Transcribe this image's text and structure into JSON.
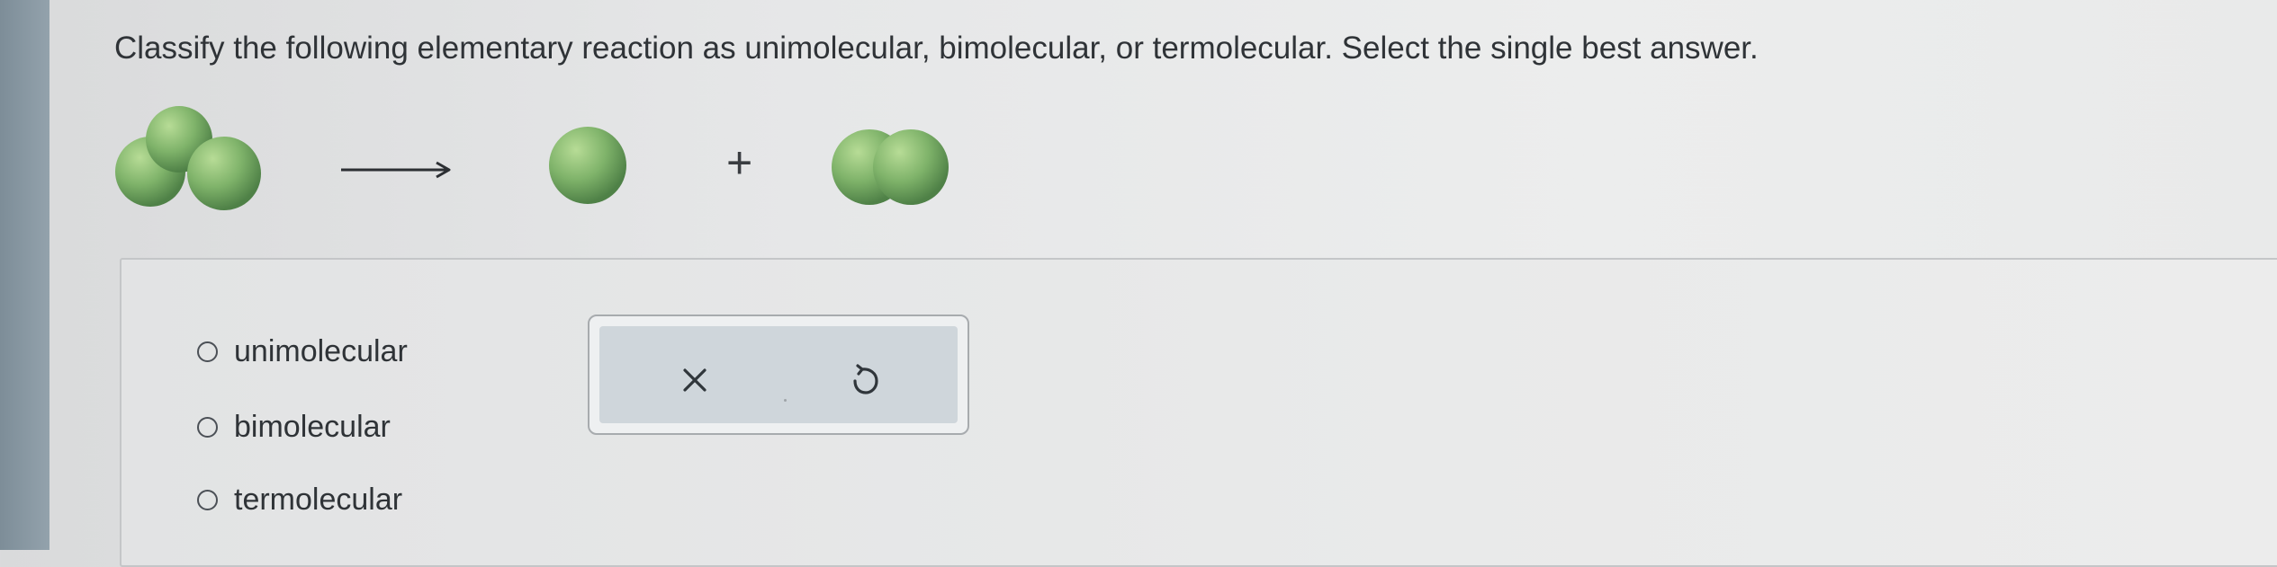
{
  "question": {
    "text": "Classify the following elementary reaction as unimolecular, bimolecular, or termolecular. Select the single best answer."
  },
  "reaction": {
    "reactant_icon": "triatomic-molecule-icon",
    "arrow_icon": "reaction-arrow-icon",
    "product_1_icon": "single-atom-icon",
    "plus_text": "+",
    "product_2_icon": "diatomic-molecule-icon",
    "atom_color": "#7fb36a"
  },
  "options": [
    {
      "label": "unimolecular",
      "selected": false
    },
    {
      "label": "bimolecular",
      "selected": false
    },
    {
      "label": "termolecular",
      "selected": false
    }
  ],
  "controls": {
    "clear_icon": "close-icon",
    "undo_icon": "undo-icon"
  }
}
